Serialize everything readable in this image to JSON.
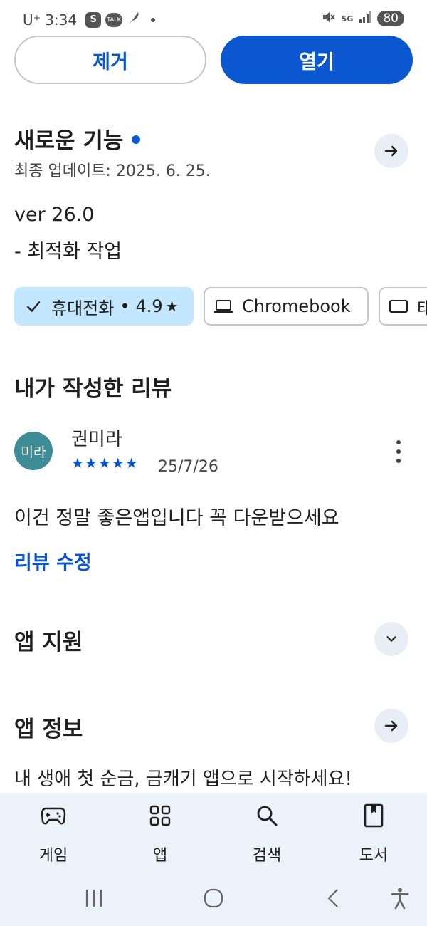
{
  "status_bar": {
    "carrier": "U⁺",
    "time": "3:34",
    "app_icons": [
      "s-app-icon",
      "kakaotalk-icon",
      "feather-icon"
    ],
    "talk_label": "TALK",
    "s_label": "S",
    "network": "5G",
    "battery": "80"
  },
  "actions": {
    "remove_label": "제거",
    "open_label": "열기"
  },
  "whats_new": {
    "title": "새로운 기능",
    "updated": "최종 업데이트: 2025. 6. 25.",
    "version": "ver 26.0",
    "note": "- 최적화 작업"
  },
  "devices": {
    "phone": {
      "label": "휴대전화",
      "rating": "4.9",
      "star": "★",
      "selected": true
    },
    "chromebook": {
      "label": "Chromebook"
    },
    "tablet": {
      "label": "태블릿"
    }
  },
  "my_review": {
    "title": "내가 작성한 리뷰",
    "avatar_text": "미라",
    "reviewer": "권미라",
    "stars": "★★★★★",
    "rating": 5,
    "date": "25/7/26",
    "text": "이건 정말 좋은앱입니다 꼭 다운받으세요",
    "edit_label": "리뷰 수정"
  },
  "app_support": {
    "title": "앱 지원"
  },
  "app_info": {
    "title": "앱 정보",
    "description": "내 생애 첫 순금, 금캐기 앱으로 시작하세요!"
  },
  "bottom_nav": {
    "items": [
      {
        "label": "게임",
        "icon": "gamepad-icon"
      },
      {
        "label": "앱",
        "icon": "apps-grid-icon"
      },
      {
        "label": "검색",
        "icon": "search-icon"
      },
      {
        "label": "도서",
        "icon": "book-icon"
      }
    ]
  },
  "colors": {
    "accent": "#0b57d0",
    "chip_selected": "#c2e7ff",
    "nav_bg": "#edf2fa",
    "avatar": "#3f8c99"
  }
}
